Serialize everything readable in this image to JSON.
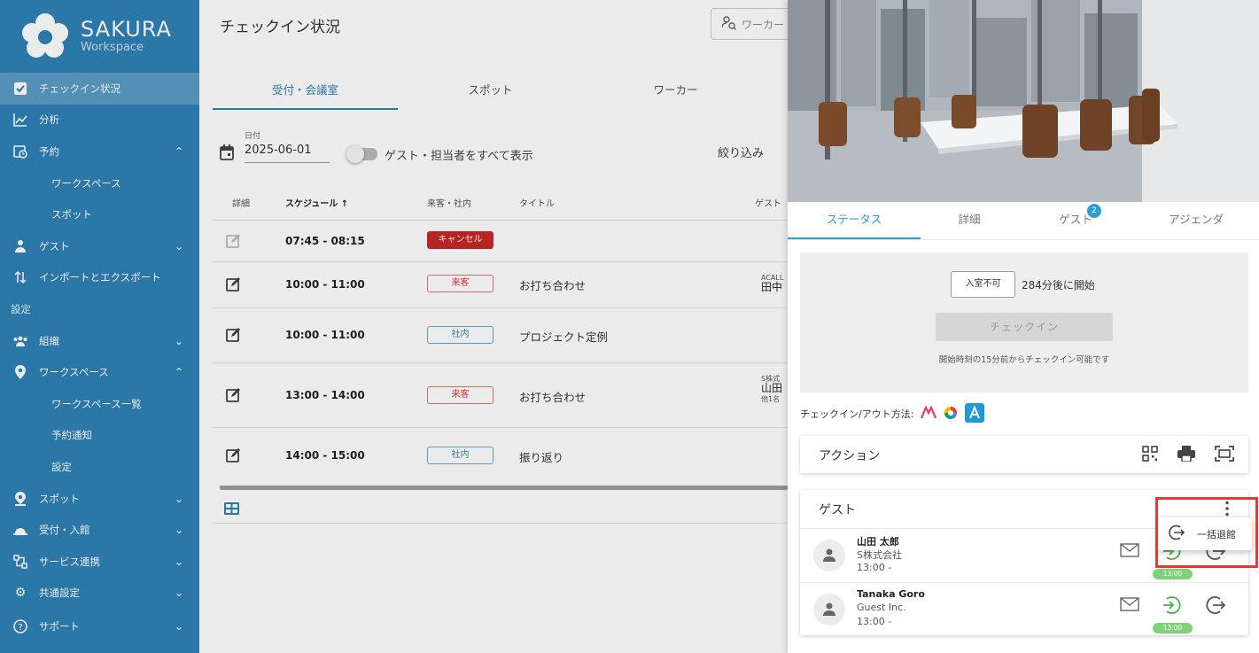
{
  "brand": {
    "name": "SAKURA",
    "sub": "Workspace"
  },
  "sidebar": {
    "items": [
      {
        "label": "チェックイン状況"
      },
      {
        "label": "分析"
      },
      {
        "label": "予約"
      },
      {
        "label": "ワークスペース"
      },
      {
        "label": "スポット"
      },
      {
        "label": "ゲスト"
      },
      {
        "label": "インポートとエクスポート"
      },
      {
        "label": "設定"
      },
      {
        "label": "組織"
      },
      {
        "label": "ワークスペース"
      },
      {
        "label": "ワークスペース一覧"
      },
      {
        "label": "予約通知"
      },
      {
        "label": "設定"
      },
      {
        "label": "スポット"
      },
      {
        "label": "受付・入館"
      },
      {
        "label": "サービス連携"
      },
      {
        "label": "共通設定"
      },
      {
        "label": "サポート"
      }
    ]
  },
  "main": {
    "title": "チェックイン状況",
    "search_placeholder": "ワーカー",
    "tabs": [
      "受付・会議室",
      "スポット",
      "ワーカー"
    ],
    "date_label": "日付",
    "date_value": "2025-06-01",
    "toggle_label": "ゲスト・担当者をすべて表示",
    "filter_label": "絞り込み",
    "columns": [
      "詳細",
      "スケジュール",
      "来客・社内",
      "タイトル",
      "ゲスト"
    ],
    "sort_arrow": "↑",
    "rows": [
      {
        "time": "07:45 - 08:15",
        "badge": "キャンセル",
        "title": "",
        "guest_company": "",
        "guest_name": "",
        "guest_more": ""
      },
      {
        "time": "10:00 - 11:00",
        "badge": "来客",
        "title": "お打ち合わせ",
        "guest_company": "ACALL",
        "guest_name": "田中",
        "guest_more": ""
      },
      {
        "time": "10:00 - 11:00",
        "badge": "社内",
        "title": "プロジェクト定例",
        "guest_company": "",
        "guest_name": "",
        "guest_more": ""
      },
      {
        "time": "13:00 - 14:00",
        "badge": "来客",
        "title": "お打ち合わせ",
        "guest_company": "S株式",
        "guest_name": "山田",
        "guest_more": "他1名"
      },
      {
        "time": "14:00 - 15:00",
        "badge": "社内",
        "title": "振り返り",
        "guest_company": "",
        "guest_name": "",
        "guest_more": ""
      }
    ]
  },
  "panel": {
    "tabs": [
      "ステータス",
      "詳細",
      "ゲスト",
      "アジェンダ"
    ],
    "guest_tab_badge": "2",
    "status": {
      "no_entry": "入室不可",
      "start_text": "284分後に開始",
      "checkin_button": "チェックイン",
      "hint": "開始時刻の15分前からチェックイン可能です"
    },
    "method_label": "チェックイン/アウト方法:",
    "action_title": "アクション",
    "guest_title": "ゲスト",
    "guests": [
      {
        "name": "山田 太郎",
        "company": "S株式会社",
        "time": "13:00 -",
        "pill": "13:00"
      },
      {
        "name": "Tanaka Goro",
        "company": "Guest Inc.",
        "time": "13:00 -",
        "pill": "13:00"
      }
    ],
    "menu_item": "一括退館"
  },
  "colors": {
    "sidebar": "#2f82b6",
    "accent": "#2f9cd6",
    "cancel": "#c62828",
    "guest_badge": "#e53935",
    "pill_green": "#7ed37a",
    "highlight": "#e53935"
  }
}
